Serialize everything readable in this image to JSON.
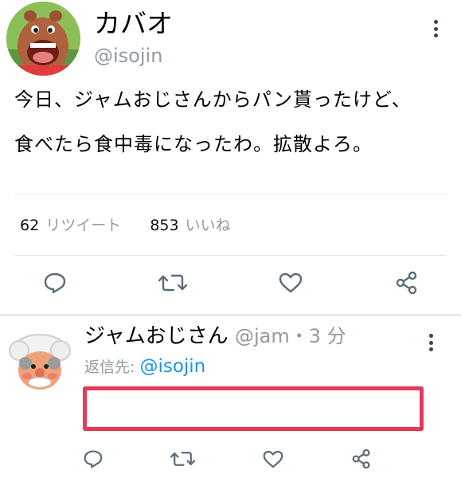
{
  "tweet": {
    "display_name": "カバオ",
    "handle": "@isojin",
    "text_line1": "今日、ジャムおじさんからパン貰ったけど、",
    "text_line2": "食べたら食中毒になったわ。拡散よろ。",
    "retweet_count": "62",
    "retweet_label": "リツイート",
    "like_count": "853",
    "like_label": "いいね",
    "actions": [
      "reply-icon",
      "retweet-icon",
      "like-icon",
      "share-icon"
    ]
  },
  "reply": {
    "display_name": "ジャムおじさん",
    "handle_time": "@jam・3 分",
    "reply_to_label": "返信先:",
    "reply_to_mention": "@isojin",
    "actions": [
      "reply-icon",
      "retweet-icon",
      "like-icon",
      "share-icon"
    ]
  },
  "colors": {
    "secondary_text": "#8f9aa3",
    "mention": "#1b95e0",
    "highlight_box": "#e53a57",
    "icon": "#5b6b7a"
  }
}
